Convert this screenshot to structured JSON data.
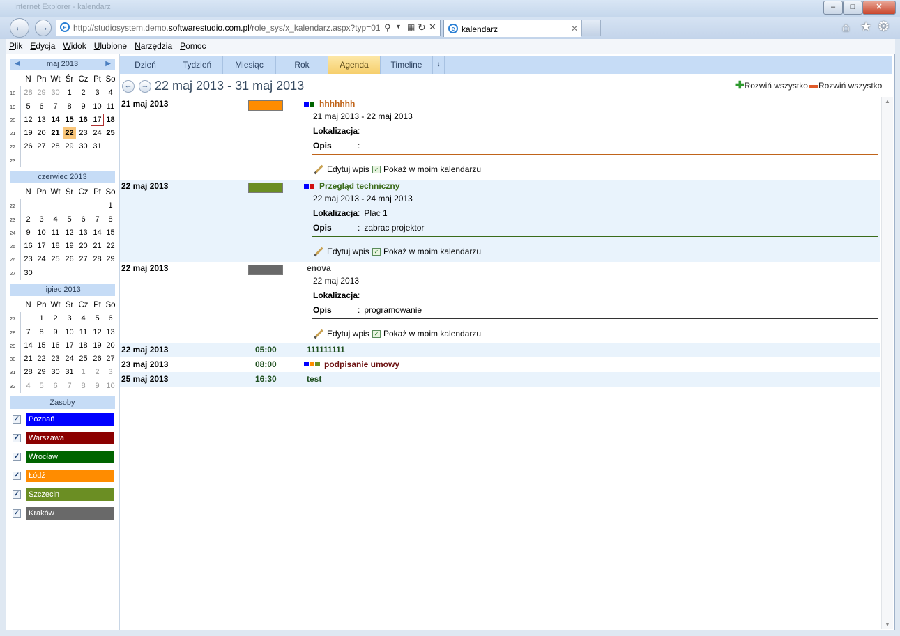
{
  "browser": {
    "window_title": "Internet Explorer - kalendarz",
    "url_prefix": "http://studiosystem.demo.",
    "url_domain": "softwarestudio.com.pl",
    "url_path": "/role_sys/x_kalendarz.aspx?typ=01",
    "tab_title": "kalendarz",
    "menu": [
      "Plik",
      "Edycja",
      "Widok",
      "Ulubione",
      "Narzędzia",
      "Pomoc"
    ]
  },
  "views": [
    "Dzień",
    "Tydzień",
    "Miesiąc",
    "Rok",
    "Agenda",
    "Timeline"
  ],
  "active_view": "Agenda",
  "date_range": "22 maj 2013 - 31 maj 2013",
  "expand_all": "Rozwiń wszystko",
  "collapse_all": "Rozwiń wszystko",
  "day_headers": [
    "N",
    "Pn",
    "Wt",
    "Śr",
    "Cz",
    "Pt",
    "So"
  ],
  "months": [
    {
      "title": "maj 2013",
      "weeks": [
        "18",
        "19",
        "20",
        "21",
        "22",
        "23"
      ],
      "rows": [
        [
          "28",
          "29",
          "30",
          "1",
          "2",
          "3",
          "4"
        ],
        [
          "5",
          "6",
          "7",
          "8",
          "9",
          "10",
          "11"
        ],
        [
          "12",
          "13",
          "14",
          "15",
          "16",
          "17",
          "18"
        ],
        [
          "19",
          "20",
          "21",
          "22",
          "23",
          "24",
          "25"
        ],
        [
          "26",
          "27",
          "28",
          "29",
          "30",
          "31",
          ""
        ],
        [
          "",
          "",
          "",
          "",
          "",
          "",
          ""
        ]
      ]
    },
    {
      "title": "czerwiec 2013",
      "weeks": [
        "22",
        "23",
        "24",
        "25",
        "26",
        "27"
      ],
      "rows": [
        [
          "",
          "",
          "",
          "",
          "",
          "",
          "1"
        ],
        [
          "2",
          "3",
          "4",
          "5",
          "6",
          "7",
          "8"
        ],
        [
          "9",
          "10",
          "11",
          "12",
          "13",
          "14",
          "15"
        ],
        [
          "16",
          "17",
          "18",
          "19",
          "20",
          "21",
          "22"
        ],
        [
          "23",
          "24",
          "25",
          "26",
          "27",
          "28",
          "29"
        ],
        [
          "30",
          "",
          "",
          "",
          "",
          "",
          ""
        ]
      ]
    },
    {
      "title": "lipiec 2013",
      "weeks": [
        "27",
        "28",
        "29",
        "30",
        "31",
        "32"
      ],
      "rows": [
        [
          "",
          "1",
          "2",
          "3",
          "4",
          "5",
          "6"
        ],
        [
          "7",
          "8",
          "9",
          "10",
          "11",
          "12",
          "13"
        ],
        [
          "14",
          "15",
          "16",
          "17",
          "18",
          "19",
          "20"
        ],
        [
          "21",
          "22",
          "23",
          "24",
          "25",
          "26",
          "27"
        ],
        [
          "28",
          "29",
          "30",
          "31",
          "1",
          "2",
          "3"
        ],
        [
          "4",
          "5",
          "6",
          "7",
          "8",
          "9",
          "10"
        ]
      ]
    }
  ],
  "resources_title": "Zasoby",
  "resources": [
    {
      "name": "Poznań",
      "color": "#0000ff"
    },
    {
      "name": "Warszawa",
      "color": "#8b0000"
    },
    {
      "name": "Wrocław",
      "color": "#006400"
    },
    {
      "name": "Łódź",
      "color": "#ff8c00"
    },
    {
      "name": "Szczecin",
      "color": "#6b8e23"
    },
    {
      "name": "Kraków",
      "color": "#696969"
    }
  ],
  "labels": {
    "location": "Lokalizacja",
    "description": "Opis",
    "colon": ":",
    "edit": "Edytuj wpis",
    "show": "Pokaż w moim kalendarzu"
  },
  "events": [
    {
      "date": "21 maj 2013",
      "title": "hhhhhhh",
      "title_color": "#c0641a",
      "swatch": "#ff8c00",
      "squares": [
        "#0000ff",
        "#006400"
      ],
      "range": "21 maj 2013 - 22 maj 2013",
      "location": "",
      "description": "",
      "sep_color": "#c0641a"
    },
    {
      "date": "22 maj 2013",
      "title": "Przegląd techniczny",
      "title_color": "#3a6b1a",
      "swatch": "#6b8e23",
      "squares": [
        "#0000ff",
        "#d01010"
      ],
      "range": "22 maj 2013 - 24 maj 2013",
      "location": "Plac 1",
      "description": "zabrac projektor",
      "sep_color": "#3a6b1a"
    },
    {
      "date": "22 maj 2013",
      "title": "enova",
      "title_color": "#333333",
      "swatch": "#696969",
      "squares": [],
      "range": "22 maj 2013",
      "location": "",
      "description": "programowanie",
      "sep_color": "#333333"
    }
  ],
  "short_events": [
    {
      "date": "22 maj 2013",
      "time": "05:00",
      "title": "111111111",
      "title_color": "#1f4f1f",
      "squares": []
    },
    {
      "date": "23 maj 2013",
      "time": "08:00",
      "title": "podpisanie umowy",
      "title_color": "#6b1010",
      "squares": [
        "#0000ff",
        "#ff8c00",
        "#6b8e23"
      ]
    },
    {
      "date": "25 maj 2013",
      "time": "16:30",
      "title": "test",
      "title_color": "#1f4f1f",
      "squares": []
    }
  ]
}
